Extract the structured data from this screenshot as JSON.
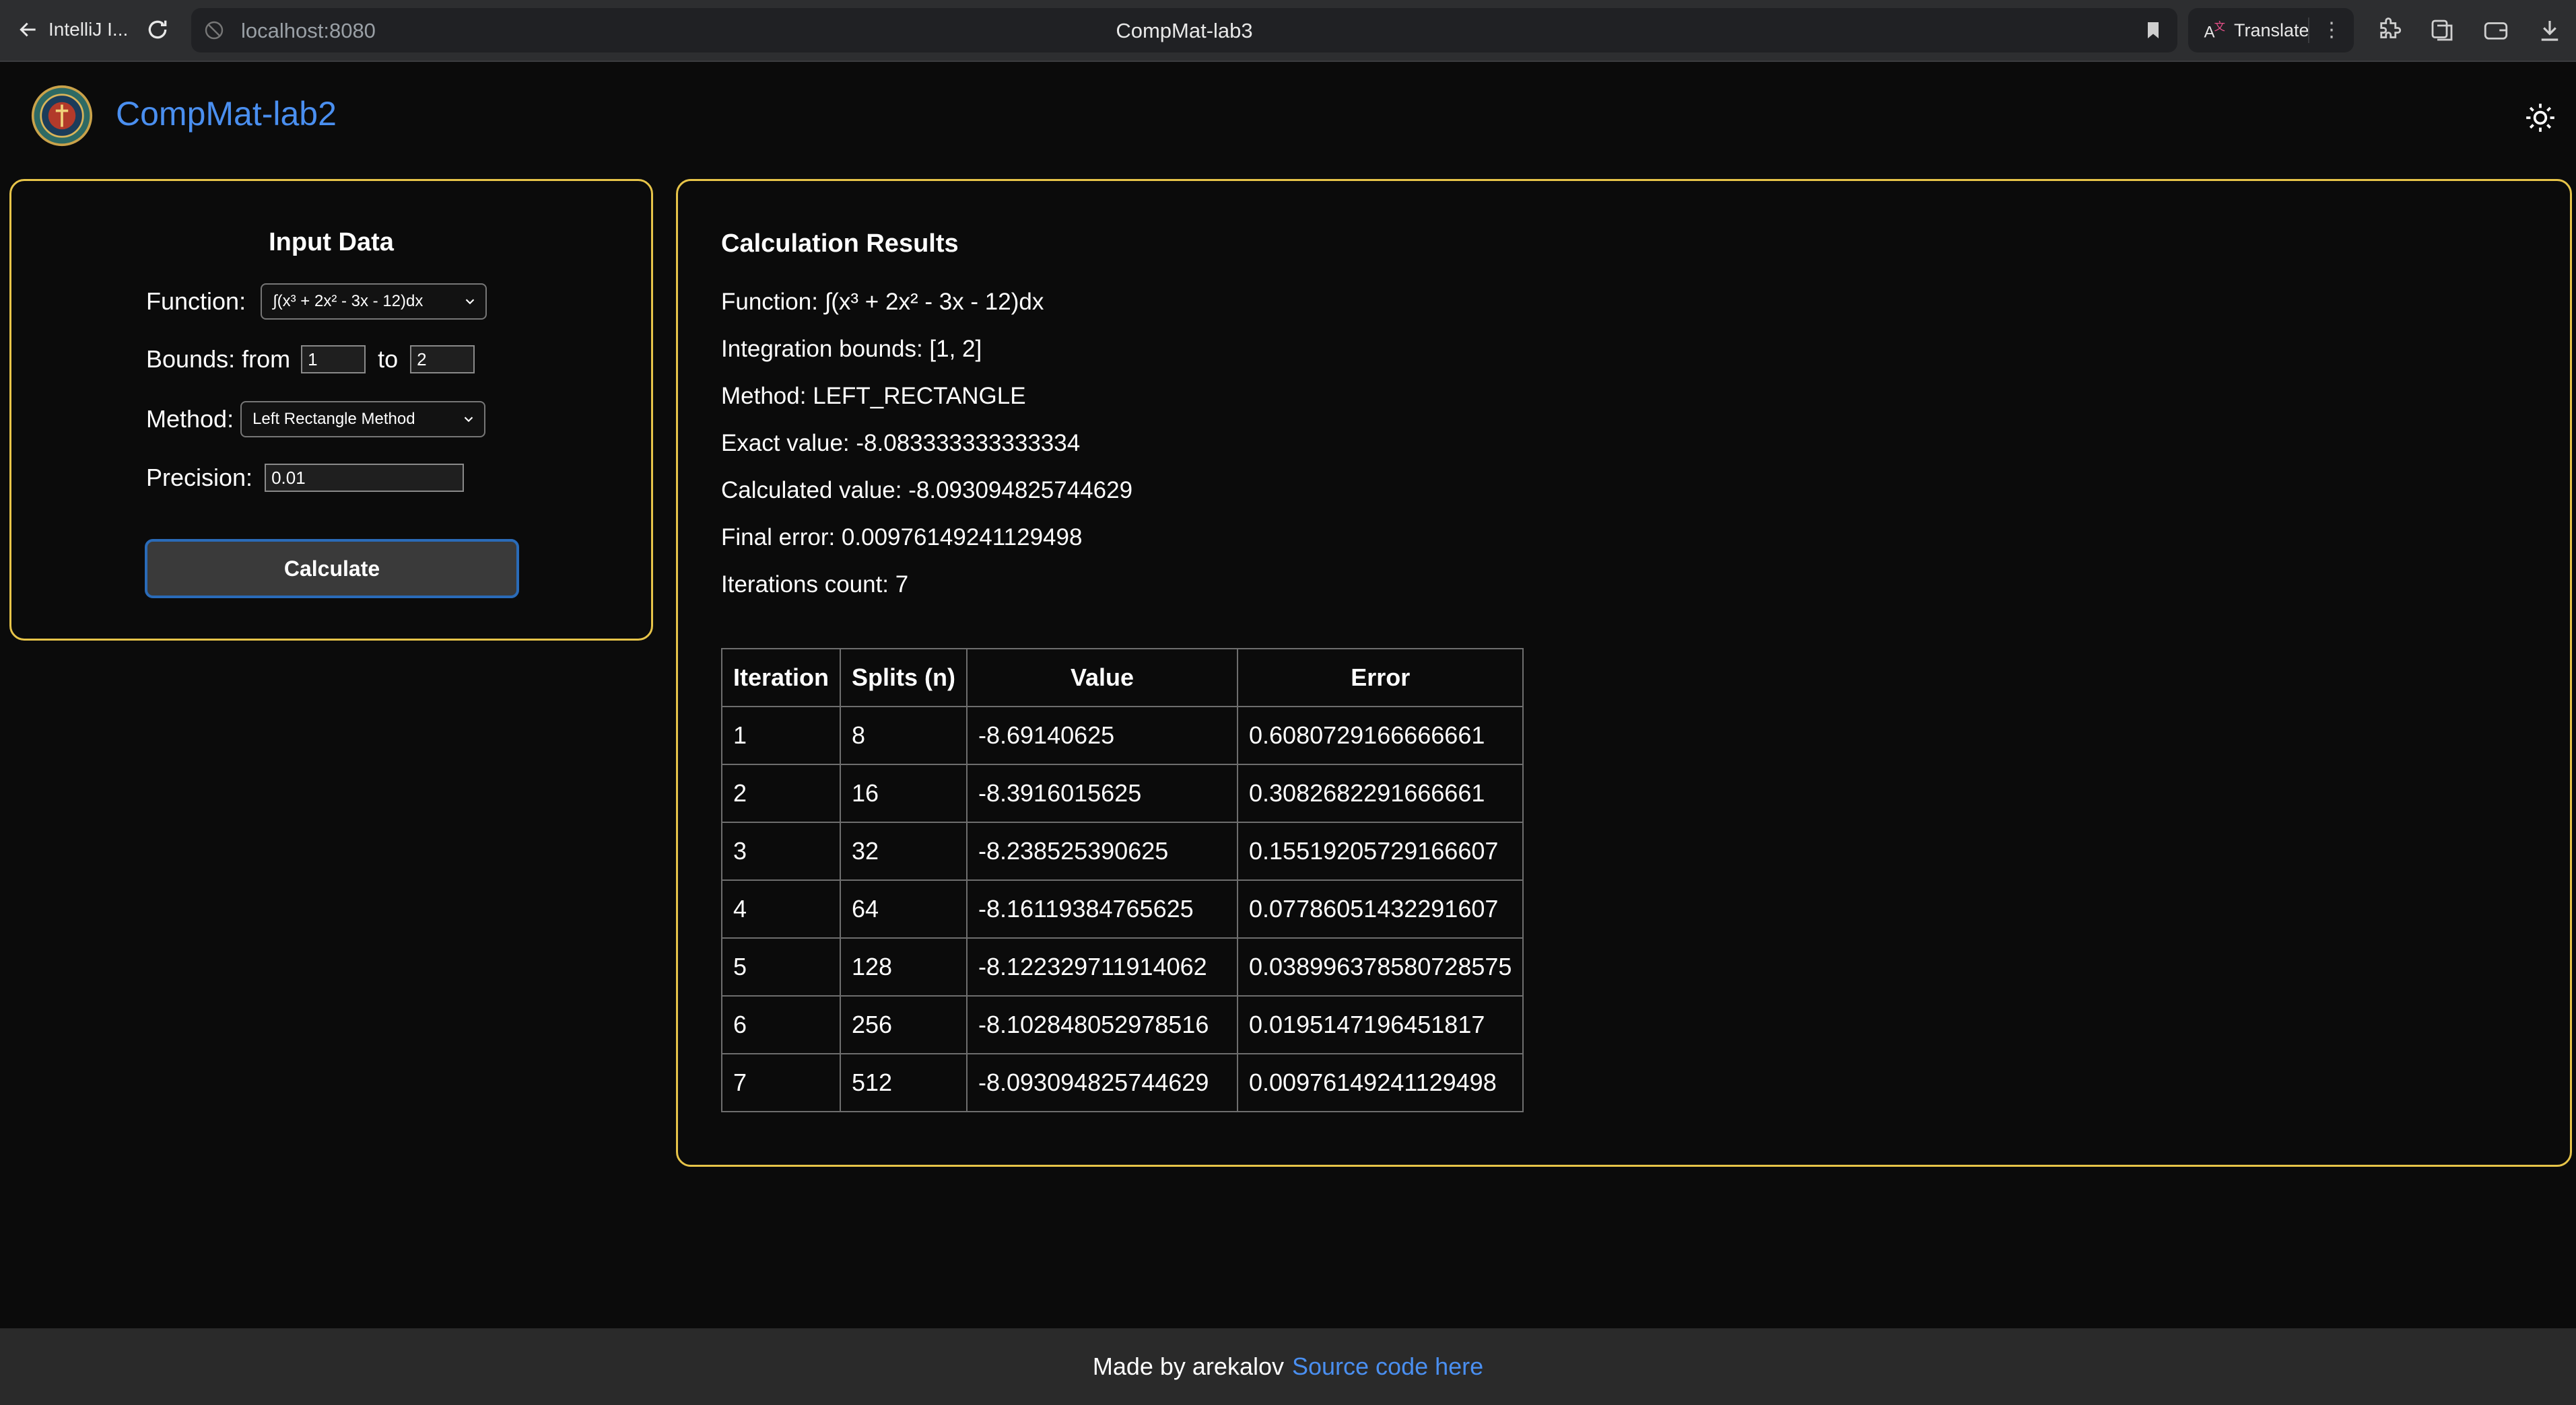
{
  "browser": {
    "back_label": "IntelliJ I...",
    "url": "localhost:8080",
    "tab_title": "CompMat-lab3",
    "translate_label": "Translate"
  },
  "app": {
    "title": "CompMat-lab2"
  },
  "input": {
    "heading": "Input Data",
    "function_label": "Function:",
    "function_value": "∫(x³ + 2x² - 3x - 12)dx",
    "bounds_label": "Bounds: from",
    "bounds_from": "1",
    "bounds_to_label": "to",
    "bounds_to": "2",
    "method_label": "Method:",
    "method_value": "Left Rectangle Method",
    "precision_label": "Precision:",
    "precision_value": "0.01",
    "calculate_label": "Calculate"
  },
  "results": {
    "heading": "Calculation Results",
    "function_line": "Function: ∫(x³ + 2x² - 3x - 12)dx",
    "bounds_line": "Integration bounds: [1, 2]",
    "method_line": "Method: LEFT_RECTANGLE",
    "exact_line": "Exact value: -8.083333333333334",
    "calculated_line": "Calculated value: -8.093094825744629",
    "error_line": "Final error: 0.00976149241129498",
    "iterations_line": "Iterations count: 7",
    "table": {
      "headers": [
        "Iteration",
        "Splits (n)",
        "Value",
        "Error"
      ],
      "rows": [
        [
          "1",
          "8",
          "-8.69140625",
          "0.6080729166666661"
        ],
        [
          "2",
          "16",
          "-8.3916015625",
          "0.3082682291666661"
        ],
        [
          "3",
          "32",
          "-8.238525390625",
          "0.15519205729166607"
        ],
        [
          "4",
          "64",
          "-8.16119384765625",
          "0.07786051432291607"
        ],
        [
          "5",
          "128",
          "-8.122329711914062",
          "0.038996378580728575"
        ],
        [
          "6",
          "256",
          "-8.102848052978516",
          "0.0195147196451817"
        ],
        [
          "7",
          "512",
          "-8.093094825744629",
          "0.00976149241129498"
        ]
      ]
    }
  },
  "footer": {
    "made_by": "Made by arekalov",
    "source_link": "Source code here"
  },
  "colors": {
    "accent_link": "#4a8ff0",
    "panel_border": "#e7c449",
    "button_border": "#2a6bb8"
  },
  "icons": {
    "back": "arrow-left-icon",
    "reload": "reload-icon",
    "site": "site-info-icon",
    "bookmark": "bookmark-icon",
    "translate": "translate-icon",
    "extensions": "puzzle-icon",
    "theme": "sun-icon"
  }
}
